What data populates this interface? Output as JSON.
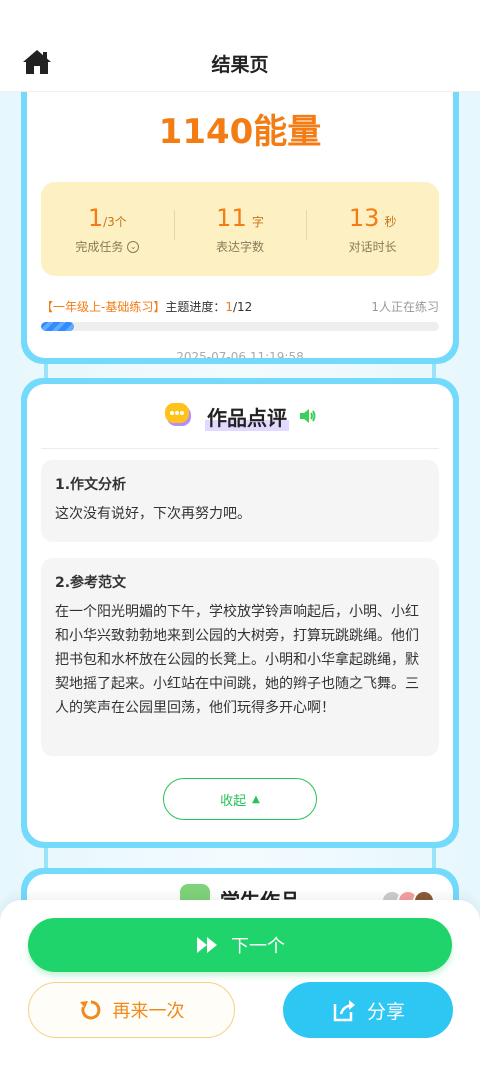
{
  "header": {
    "title": "结果页",
    "home_icon": "home-icon"
  },
  "result": {
    "energy": "1140能量",
    "stats": [
      {
        "num": "1",
        "unit": "/3个",
        "label": "完成任务"
      },
      {
        "num": "11",
        "unit": "字",
        "label": "表达字数"
      },
      {
        "num": "13",
        "unit": "秒",
        "label": "对话时长"
      }
    ],
    "progress": {
      "tag": "【一年级上-基础练习】",
      "label": "主题进度：",
      "current": "1",
      "total": "/12",
      "practice_count": "1人正在练习",
      "fraction": 0.083
    },
    "timestamp": "2025-07-06 11:19:58"
  },
  "review": {
    "title": "作品点评",
    "sections": [
      {
        "title": "1.作文分析",
        "text": "这次没有说好，下次再努力吧。"
      },
      {
        "title": "2.参考范文",
        "text": "在一个阳光明媚的下午，学校放学铃声响起后，小明、小红和小华兴致勃勃地来到公园的大树旁，打算玩跳跳绳。他们把书包和水杯放在公园的长凳上。小明和小华拿起跳绳，默契地摇了起来。小红站在中间跳，她的辫子也随之飞舞。三人的笑声在公园里回荡，他们玩得多开心啊！"
      }
    ],
    "collapse_label": "收起"
  },
  "peek": {
    "title": "学生作品"
  },
  "actions": {
    "next_label": "下一个",
    "retry_label": "再来一次",
    "share_label": "分享"
  },
  "colors": {
    "accent_orange": "#f47c14",
    "green": "#1ed46b",
    "blue": "#2ec6f2",
    "frame": "#73dafc"
  }
}
